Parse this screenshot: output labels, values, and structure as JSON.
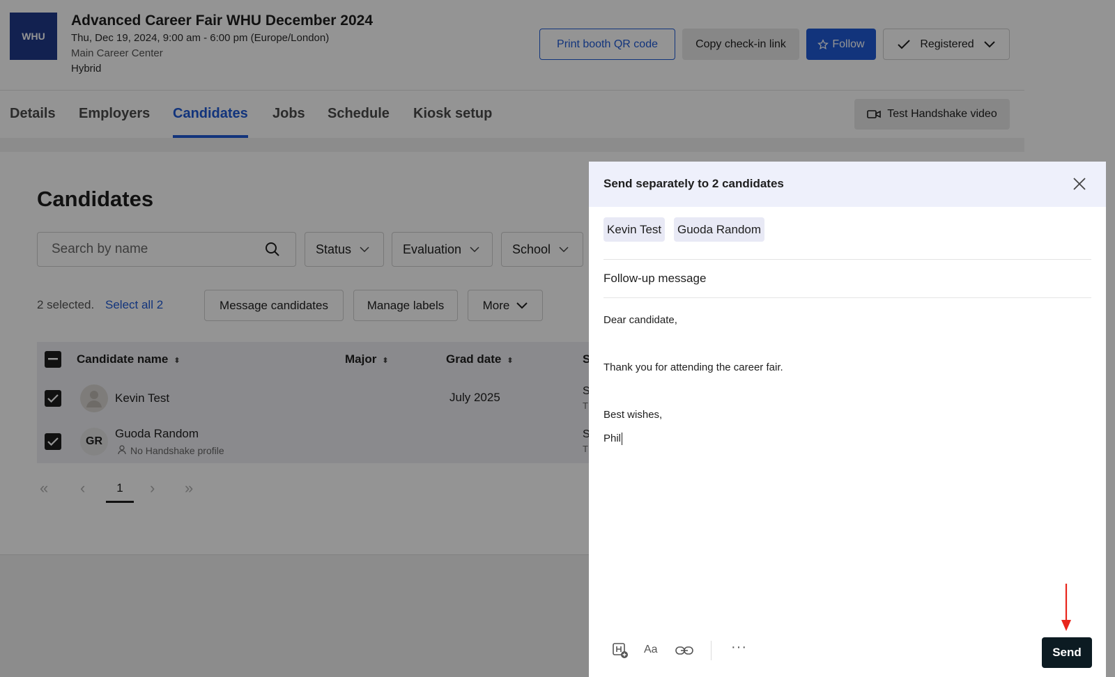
{
  "event": {
    "logo_text": "WHU",
    "title": "Advanced Career Fair WHU December 2024",
    "datetime": "Thu, Dec 19, 2024, 9:00 am - 6:00 pm (Europe/London)",
    "location": "Main Career Center",
    "type": "Hybrid"
  },
  "header_actions": {
    "print_qr": "Print booth QR code",
    "copy_link": "Copy check-in link",
    "follow": "Follow",
    "registered": "Registered"
  },
  "tabs": [
    {
      "label": "Details"
    },
    {
      "label": "Employers"
    },
    {
      "label": "Candidates"
    },
    {
      "label": "Jobs"
    },
    {
      "label": "Schedule"
    },
    {
      "label": "Kiosk setup"
    }
  ],
  "active_tab": "Candidates",
  "test_video": "Test Handshake video",
  "candidates": {
    "title": "Candidates",
    "search_placeholder": "Search by name",
    "filters": {
      "status": "Status",
      "evaluation": "Evaluation",
      "school": "School"
    },
    "selection_text": "2 selected.",
    "select_all": "Select all 2",
    "actions": {
      "message": "Message candidates",
      "labels": "Manage labels",
      "more": "More"
    },
    "columns": {
      "name": "Candidate name",
      "major": "Major",
      "grad": "Grad date",
      "next": "S"
    },
    "rows": [
      {
        "name": "Kevin Test",
        "grad": "July 2025",
        "peek": "S",
        "peek2": "T",
        "initials": "",
        "note": ""
      },
      {
        "name": "Guoda Random",
        "grad": "",
        "peek": "S",
        "peek2": "T",
        "initials": "GR",
        "note": "No Handshake profile"
      }
    ],
    "pager": {
      "first": "«",
      "prev": "‹",
      "page": "1",
      "next": "›",
      "last": "»"
    }
  },
  "modal": {
    "title": "Send separately to 2 candidates",
    "recipients": [
      "Kevin Test",
      "Guoda Random"
    ],
    "subject": "Follow-up message",
    "body": {
      "greeting": "Dear candidate,",
      "line": "Thank you for attending the career fair.",
      "closing": "Best wishes,",
      "signature": "Phil"
    },
    "toolbar": {
      "format": "Aa",
      "more": "···"
    },
    "send": "Send"
  },
  "colors": {
    "accent": "#1f5bd6",
    "send_bg": "#0c1b22",
    "annotation": "#e8261c"
  }
}
